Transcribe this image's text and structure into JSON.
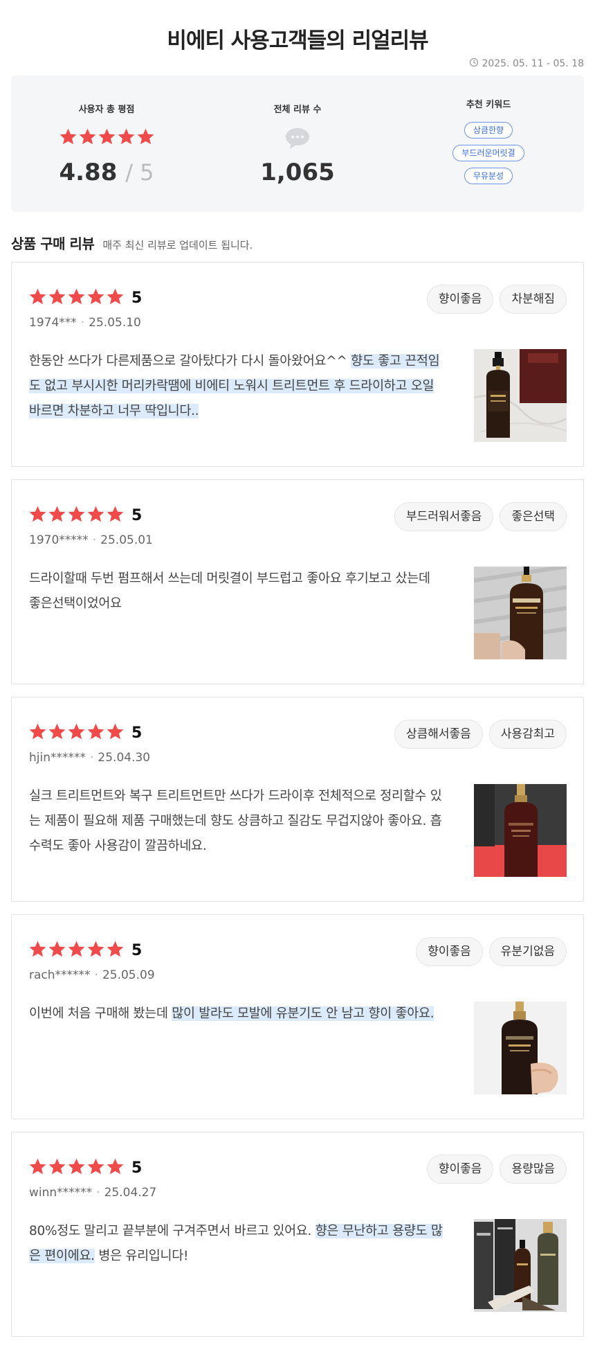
{
  "header": {
    "title": "비에티 사용고객들의 리얼리뷰",
    "period": "2025. 05. 11 - 05. 18"
  },
  "summary": {
    "rating_label": "사용자 총 평점",
    "rating_value": "4.88",
    "rating_max": "/ 5",
    "count_label": "전체 리뷰 수",
    "count_value": "1,065",
    "keyword_label": "추천 키워드",
    "keywords": [
      "상큼한향",
      "부드러운머릿결",
      "무유분성"
    ]
  },
  "section": {
    "title": "상품 구매 리뷰",
    "subtitle": "매주 최신 리뷰로 업데이트 됩니다."
  },
  "reviews": [
    {
      "score": "5",
      "user": "1974***",
      "date": "25.05.10",
      "tags": [
        "향이좋음",
        "차분해짐"
      ],
      "text_plain": "한동안 쓰다가 다른제품으로 갈아탔다가 다시 돌아왔어요^^ ",
      "text_highlight": "향도 좋고 끈적임도 없고 부시시한 머리카락땜에 비에티 노워시 트리트먼트 후 드라이하고 오일바르면 차분하고 너무 딱입니다..",
      "text_after": ""
    },
    {
      "score": "5",
      "user": "1970*****",
      "date": "25.05.01",
      "tags": [
        "부드러워서좋음",
        "좋은선택"
      ],
      "text_plain": "드라이할때 두번 펌프해서 쓰는데 머릿결이 부드럽고 좋아요 후기보고 샀는데 좋은선택이었어요",
      "text_highlight": "",
      "text_after": ""
    },
    {
      "score": "5",
      "user": "hjin******",
      "date": "25.04.30",
      "tags": [
        "상큼해서좋음",
        "사용감최고"
      ],
      "text_plain": "실크 트리트먼트와 복구 트리트먼트만 쓰다가 드라이후 전체적으로 정리할수 있는 제품이 필요해 제품 구매했는데 향도 상큼하고 질감도 무겁지않아 좋아요. 흡수력도 좋아 사용감이 깔끔하네요.",
      "text_highlight": "",
      "text_after": ""
    },
    {
      "score": "5",
      "user": "rach******",
      "date": "25.05.09",
      "tags": [
        "향이좋음",
        "유분기없음"
      ],
      "text_plain": "이번에 처음 구매해 봤는데 ",
      "text_highlight": "많이 발라도 모발에 유분기도 안 남고 향이 좋아요.",
      "text_after": ""
    },
    {
      "score": "5",
      "user": "winn******",
      "date": "25.04.27",
      "tags": [
        "향이좋음",
        "용량많음"
      ],
      "text_plain": "80%정도 말리고 끝부분에 구겨주면서 바르고 있어요. ",
      "text_highlight": "향은 무난하고 용량도 많은 편이에요.",
      "text_after": " 병은 유리입니다!"
    }
  ],
  "colors": {
    "star": "#ef4b4b",
    "highlight": "#dcebfb",
    "keyword_chip": "#3b6fd8",
    "summary_bg": "#f5f6f8"
  },
  "icons": [
    "clock-icon",
    "star-icon",
    "chat-bubble-icon"
  ]
}
